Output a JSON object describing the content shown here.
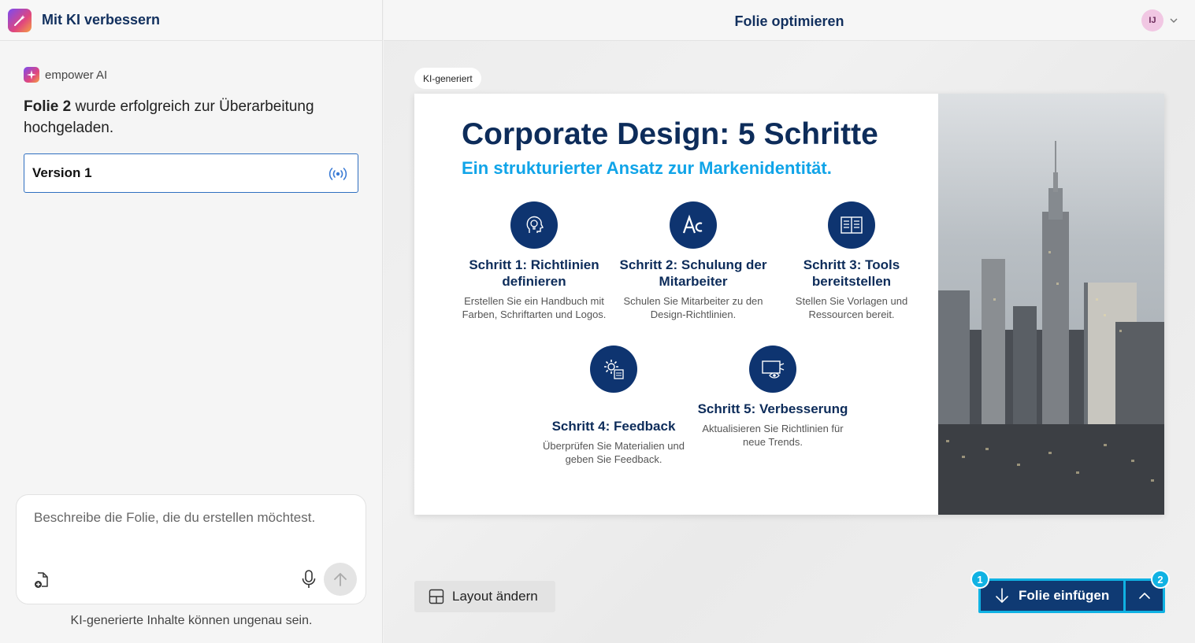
{
  "left_panel": {
    "title": "Mit KI verbessern",
    "ai_label": "empower AI",
    "status_bold": "Folie 2",
    "status_rest": " wurde erfolgreich zur Überarbeitung hochgeladen.",
    "version_label": "Version 1",
    "prompt_placeholder": "Beschreibe die Folie, die du erstellen möchtest.",
    "disclaimer": "KI-generierte Inhalte können ungenau sein."
  },
  "main": {
    "title": "Folie optimieren",
    "avatar_initials": "IJ",
    "badge": "KI-generiert",
    "layout_button": "Layout ändern",
    "insert_button": "Folie einfügen",
    "callout_1": "1",
    "callout_2": "2"
  },
  "slide": {
    "title": "Corporate Design: 5 Schritte",
    "subtitle": "Ein strukturierter Ansatz zur Markenidentität.",
    "steps": [
      {
        "title": "Schritt 1: Richtlinien definieren",
        "desc": "Erstellen Sie ein Handbuch mit Farben, Schriftarten und Logos.",
        "icon": "lightbulb-head-icon"
      },
      {
        "title": "Schritt 2: Schulung der Mitarbeiter",
        "desc": "Schulen Sie Mitarbeiter zu den Design-Richtlinien.",
        "icon": "typography-icon"
      },
      {
        "title": "Schritt 3: Tools bereitstellen",
        "desc": "Stellen Sie Vorlagen und Ressourcen bereit.",
        "icon": "book-icon"
      },
      {
        "title": "Schritt 4: Feedback",
        "desc": "Überprüfen Sie Materialien und geben Sie Feedback.",
        "icon": "gear-document-icon"
      },
      {
        "title": "Schritt 5: Verbesserung",
        "desc": "Aktualisieren Sie Richtlinien für neue Trends.",
        "icon": "monitor-eye-icon"
      }
    ]
  },
  "colors": {
    "brand_dark": "#0d2c5a",
    "accent_cyan": "#10b2e3",
    "subtitle_blue": "#10a4e8",
    "insert_bg": "#0f3a73"
  }
}
